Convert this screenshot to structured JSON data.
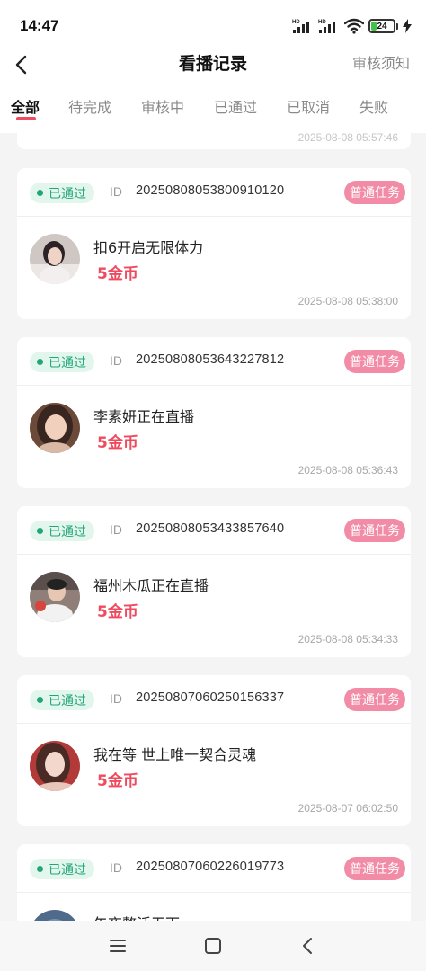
{
  "status_bar": {
    "time": "14:47",
    "network_1": "HD",
    "network_2": "HD",
    "battery": "24",
    "battery_level_percent": 24,
    "charging": true
  },
  "header": {
    "title": "看播记录",
    "notice_label": "审核须知"
  },
  "tabs": [
    {
      "label": "全部",
      "active": true
    },
    {
      "label": "待完成",
      "active": false
    },
    {
      "label": "审核中",
      "active": false
    },
    {
      "label": "已通过",
      "active": false
    },
    {
      "label": "已取消",
      "active": false
    },
    {
      "label": "失败",
      "active": false
    }
  ],
  "records": {
    "partial_top_time": "2025-08-08 05:57:46",
    "id_label": "ID",
    "items": [
      {
        "status": "已通过",
        "id": "20250808053800910120",
        "type": "普通任务",
        "room_name": "扣6开启无限体力",
        "reward": "5金币",
        "time": "2025-08-08 05:38:00"
      },
      {
        "status": "已通过",
        "id": "20250808053643227812",
        "type": "普通任务",
        "room_name": "李素妍正在直播",
        "reward": "5金币",
        "time": "2025-08-08 05:36:43"
      },
      {
        "status": "已通过",
        "id": "20250808053433857640",
        "type": "普通任务",
        "room_name": "福州木瓜正在直播",
        "reward": "5金币",
        "time": "2025-08-08 05:34:33"
      },
      {
        "status": "已通过",
        "id": "20250807060250156337",
        "type": "普通任务",
        "room_name": "我在等 世上唯一契合灵魂",
        "reward": "5金币",
        "time": "2025-08-07 06:02:50"
      },
      {
        "status": "已通过",
        "id": "20250807060226019773",
        "type": "普通任务",
        "room_name": "午夜整活无下",
        "reward": "",
        "time": ""
      }
    ]
  },
  "colors": {
    "accent": "#ef4a5e",
    "pass_green": "#22a57a",
    "pass_bg": "#e3f6ee",
    "task_badge": "#f28ca6",
    "page_bg": "#f4f4f4"
  }
}
